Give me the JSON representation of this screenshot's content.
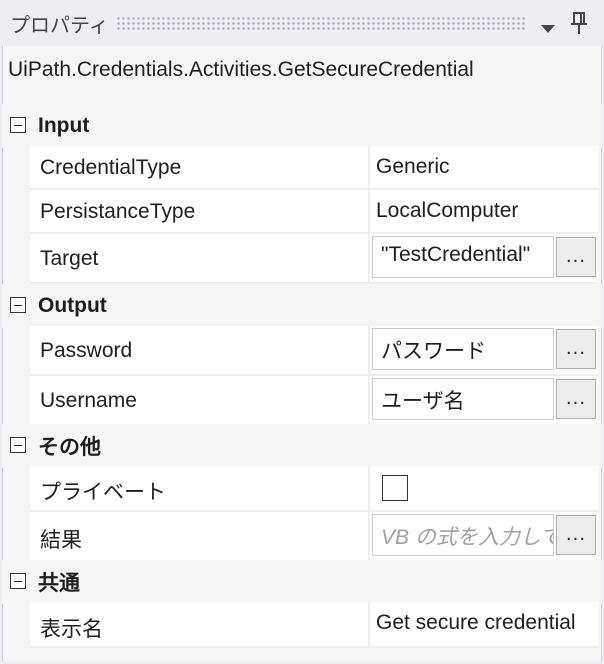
{
  "panel": {
    "title": "プロパティ",
    "activity_type": "UiPath.Credentials.Activities.GetSecureCredential"
  },
  "icons": {
    "expander": "collapse-minus-icon",
    "dropdown": "triangle-down-icon",
    "pin": "pushpin-icon",
    "browse": "ellipsis-button"
  },
  "browse_label": "...",
  "sections": [
    {
      "label": "Input",
      "rows": [
        {
          "name": "CredentialType",
          "value": "Generic"
        },
        {
          "name": "PersistanceType",
          "value": "LocalComputer"
        },
        {
          "name": "Target",
          "value": "\"TestCredential\""
        }
      ]
    },
    {
      "label": "Output",
      "rows": [
        {
          "name": "Password",
          "value": "パスワード"
        },
        {
          "name": "Username",
          "value": "ユーザ名"
        }
      ]
    },
    {
      "label": "その他",
      "rows": [
        {
          "name": "プライベート",
          "value": ""
        },
        {
          "name": "結果",
          "placeholder": "VB の式を入力してください"
        }
      ]
    },
    {
      "label": "共通",
      "rows": [
        {
          "name": "表示名",
          "value": "Get secure credential"
        }
      ]
    }
  ],
  "colors": {
    "panel_bg": "#eeeef2",
    "row_bg": "#ffffff",
    "text": "#1e1e1e",
    "placeholder": "#a0a0a0"
  }
}
